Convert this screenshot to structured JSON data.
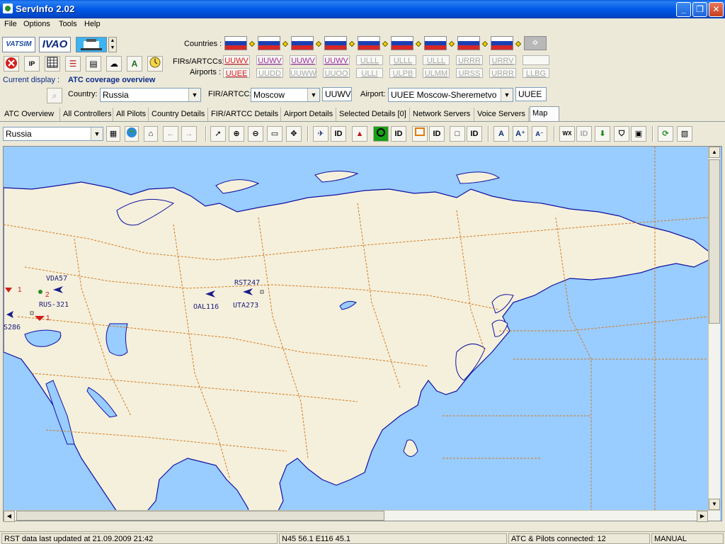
{
  "window": {
    "title": "ServInfo 2.02",
    "buttons": [
      "_",
      "❐",
      "✕"
    ]
  },
  "menu": [
    "File",
    "Options",
    "Tools",
    "Help"
  ],
  "logos": {
    "vatsim": "VATSIM",
    "ivao": "IVAO"
  },
  "current_display": {
    "label": "Current display :",
    "value": "ATC coverage overview"
  },
  "labels": {
    "countries": "Countries :",
    "firs": "FIRs/ARTCCs:",
    "airports": "Airports :",
    "country": "Country:",
    "fir_artcc": "FIR/ARTCC:",
    "airport": "Airport:"
  },
  "firs_row": [
    {
      "code": "UUWV",
      "style": "red"
    },
    {
      "code": "UUWV",
      "style": "purple"
    },
    {
      "code": "UUWV",
      "style": "purple"
    },
    {
      "code": "UUWV",
      "style": "purple"
    },
    {
      "code": "ULLL",
      "style": "grey"
    },
    {
      "code": "ULLL",
      "style": "grey"
    },
    {
      "code": "ULLL",
      "style": "grey"
    },
    {
      "code": "URRR",
      "style": "grey"
    },
    {
      "code": "URRV",
      "style": "grey"
    }
  ],
  "airports_row": [
    {
      "code": "UUEE",
      "style": "red"
    },
    {
      "code": "UUDD",
      "style": "grey"
    },
    {
      "code": "UUWW",
      "style": "grey"
    },
    {
      "code": "UUOO",
      "style": "grey"
    },
    {
      "code": "ULLI",
      "style": "grey"
    },
    {
      "code": "ULPB",
      "style": "grey"
    },
    {
      "code": "ULMM",
      "style": "grey"
    },
    {
      "code": "URSS",
      "style": "grey"
    },
    {
      "code": "URRR",
      "style": "grey"
    },
    {
      "code": "LLBG",
      "style": "grey"
    }
  ],
  "selectors": {
    "country": "Russia",
    "fir": "Moscow",
    "fir_code": "UUWV",
    "airport": "UUEE Moscow-Sheremetvo",
    "airport_code": "UUEE"
  },
  "tabs": [
    "ATC Overview",
    "All Controllers",
    "All Pilots",
    "Country Details",
    "FIR/ARTCC Details",
    "Airport Details",
    "Selected Details [0]",
    "Network Servers",
    "Voice Servers",
    "Map"
  ],
  "active_tab": "Map",
  "map_toolbar": {
    "region": "Russia",
    "id_label": "ID",
    "wx_label": "WX"
  },
  "map_labels": {
    "aircraft": [
      "VDA57",
      "RUS-321",
      "OAL116",
      "RST247",
      "UTA273",
      "S286"
    ],
    "controller_counts": [
      "1",
      "2",
      "1"
    ]
  },
  "status": {
    "updated": "RST data last updated at 21.09.2009 21:42",
    "position": "N45 56.1   E116 45.1",
    "connected": "ATC & Pilots connected: 12",
    "mode": "MANUAL"
  },
  "colors": {
    "water": "#99ccff",
    "land": "#f5f0dc",
    "border": "#d47a1e",
    "coast": "#1010a0",
    "accent_red": "#d41a1a"
  }
}
